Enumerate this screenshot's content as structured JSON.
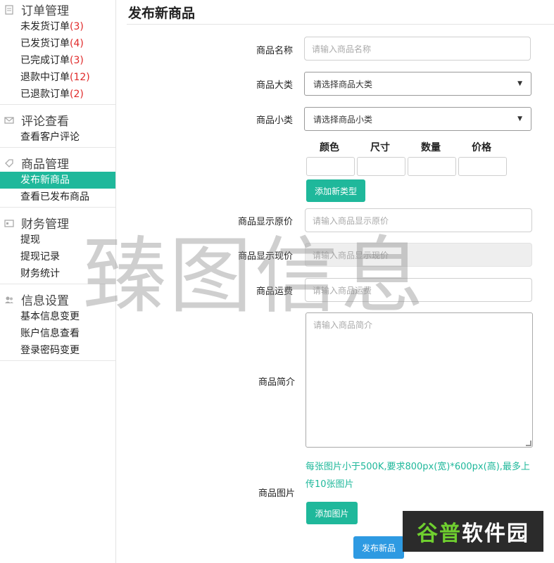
{
  "sidebar": {
    "groups": [
      {
        "title": "订单管理",
        "icon": "document-icon",
        "items": [
          {
            "label": "未发货订单",
            "count": "(3)"
          },
          {
            "label": "已发货订单",
            "count": "(4)"
          },
          {
            "label": "已完成订单",
            "count": "(3)"
          },
          {
            "label": "退款中订单",
            "count": "(12)"
          },
          {
            "label": "已退款订单",
            "count": "(2)"
          }
        ]
      },
      {
        "title": "评论查看",
        "icon": "mail-icon",
        "items": [
          {
            "label": "查看客户评论"
          }
        ]
      },
      {
        "title": "商品管理",
        "icon": "tag-icon",
        "items": [
          {
            "label": "发布新商品"
          },
          {
            "label": "查看已发布商品"
          }
        ]
      },
      {
        "title": "财务管理",
        "icon": "card-icon",
        "items": [
          {
            "label": "提现"
          },
          {
            "label": "提现记录"
          },
          {
            "label": "财务统计"
          }
        ]
      },
      {
        "title": "信息设置",
        "icon": "users-icon",
        "items": [
          {
            "label": "基本信息变更"
          },
          {
            "label": "账户信息查看"
          },
          {
            "label": "登录密码变更"
          }
        ]
      }
    ]
  },
  "main": {
    "title": "发布新商品",
    "form": {
      "name_label": "商品名称",
      "name_placeholder": "请输入商品名称",
      "category_label": "商品大类",
      "category_value": "请选择商品大类",
      "subcategory_label": "商品小类",
      "subcategory_value": "请选择商品小类",
      "spec_headers": [
        "颜色",
        "尺寸",
        "数量",
        "价格"
      ],
      "add_type_button": "添加新类型",
      "original_price_label": "商品显示原价",
      "original_price_placeholder": "请输入商品显示原价",
      "current_price_label": "商品显示现价",
      "current_price_placeholder": "请输入商品显示现价",
      "shipping_label": "商品运费",
      "shipping_placeholder": "请输入商品运费",
      "intro_label": "商品简介",
      "intro_placeholder": "请输入商品简介",
      "image_label": "商品图片",
      "image_hint": "每张图片小于500K,要求800px(宽)*600px(高),最多上传10张图片",
      "add_image_button": "添加图片",
      "submit_button": "发布新品"
    }
  },
  "watermark": "臻图信息",
  "logo": {
    "part1": "谷普",
    "part2": "软件园"
  },
  "colors": {
    "accent": "#1fb89b",
    "primary": "#2e9ae2",
    "count": "#e02a2a"
  }
}
